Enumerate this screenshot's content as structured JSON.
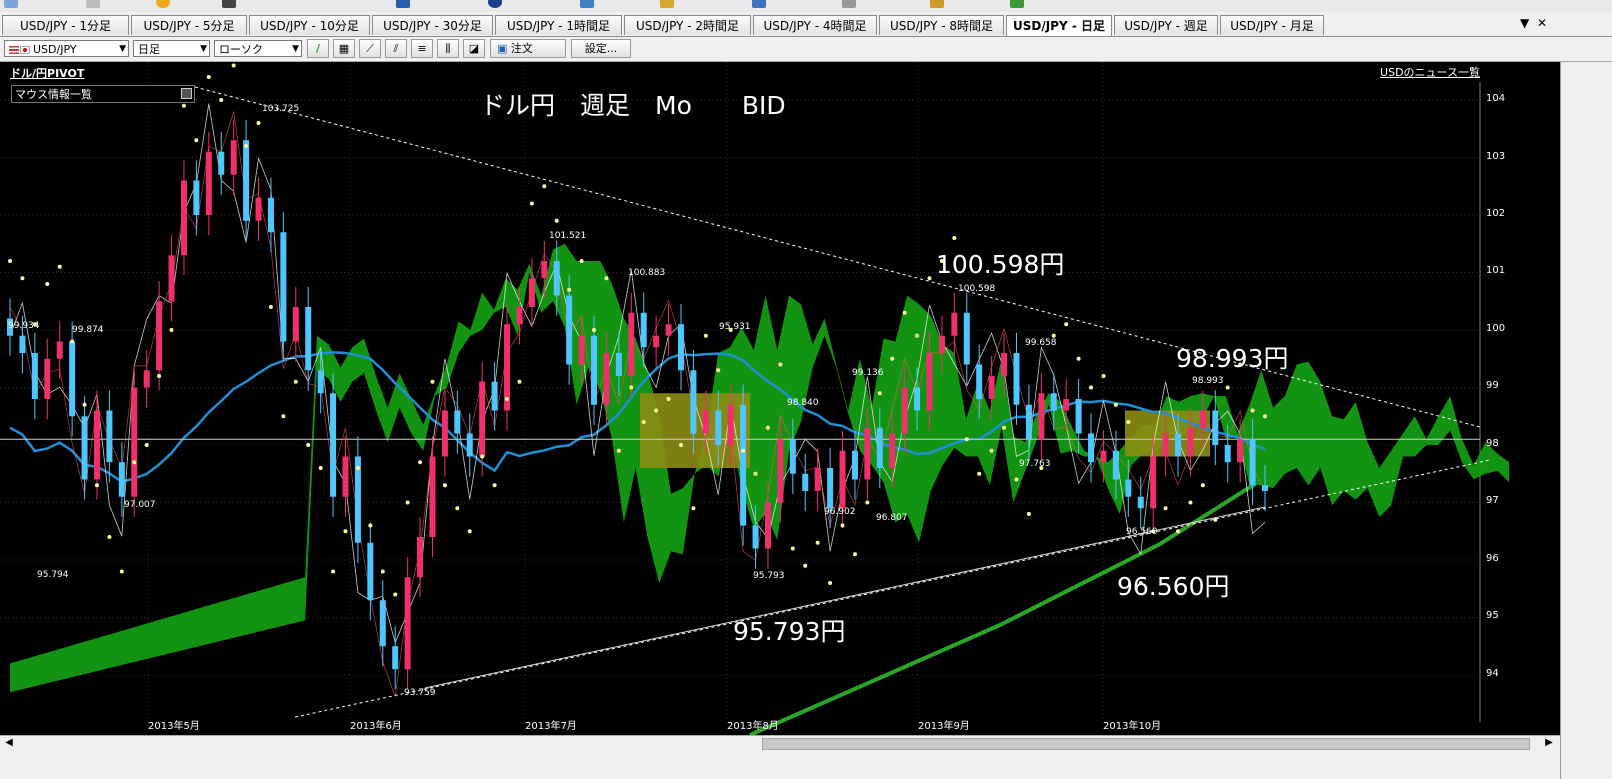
{
  "tabs": [
    "USD/JPY - 1分足",
    "USD/JPY - 5分足",
    "USD/JPY - 10分足",
    "USD/JPY - 30分足",
    "USD/JPY - 1時間足",
    "USD/JPY - 2時間足",
    "USD/JPY - 4時間足",
    "USD/JPY - 8時間足",
    "USD/JPY - 日足",
    "USD/JPY - 週足",
    "USD/JPY - 月足"
  ],
  "active_tab": "USD/JPY - 日足",
  "toolbar": {
    "pair": "USD/JPY",
    "timeframe": "日足",
    "chart_type": "ローソク",
    "order_label": "注文",
    "settings_label": "設定..."
  },
  "chart": {
    "pivot_title": "ドル/円PIVOT",
    "news_link": "USDのニュース一覧",
    "mouse_info": "マウス情報一覧",
    "headline": "ドル円　週足　Mo　　BID",
    "annotations": [
      "100.598円",
      "98.993円",
      "95.793円",
      "96.560円"
    ],
    "point_labels": [
      "103.725",
      "101.521",
      "100.883",
      "99.934",
      "99.874",
      "97.007",
      "95.794",
      "93.759",
      "95.931",
      "99.136",
      "98.840",
      "96.902",
      "96.807",
      "95.793",
      "100.598",
      "99.658",
      "97.763",
      "98.993",
      "96.560"
    ],
    "y_ticks": [
      "104",
      "103",
      "102",
      "101",
      "100",
      "99",
      "98",
      "97",
      "96",
      "95",
      "94"
    ],
    "x_ticks": [
      "2013年5月",
      "2013年6月",
      "2013年7月",
      "2013年8月",
      "2013年9月",
      "2013年10月"
    ],
    "colors": {
      "bull": "#f0306a",
      "bear": "#4ec6ff",
      "cloud": "#139c13",
      "cloud_bear": "#8c8c14",
      "ma": "#1f8fd6",
      "long_ma": "#2aa52a",
      "psar": "#ffff99"
    }
  },
  "chart_data": {
    "type": "candlestick",
    "title": "ドル円　週足　Mo　　BID",
    "pair": "USD/JPY",
    "ylim": [
      93.5,
      104.2
    ],
    "x": [
      "2013年5月",
      "2013年6月",
      "2013年7月",
      "2013年8月",
      "2013年9月",
      "2013年10月"
    ],
    "key_levels": {
      "high_may": 103.725,
      "high_jul": 101.521,
      "jul_2": 100.883,
      "high_sep": 100.598,
      "high_oct": 98.993,
      "low_jun": 93.759,
      "low_aug": 95.793,
      "low_oct": 96.56,
      "pivot_level": 98.1
    },
    "closes": [
      99.9,
      99.6,
      98.8,
      99.5,
      99.8,
      98.5,
      97.4,
      98.6,
      97.7,
      97.1,
      99.0,
      99.3,
      100.5,
      101.3,
      102.6,
      102.0,
      103.1,
      102.7,
      103.3,
      101.9,
      102.3,
      101.7,
      99.8,
      100.4,
      99.3,
      98.9,
      97.1,
      97.8,
      96.3,
      95.3,
      94.5,
      94.1,
      95.7,
      96.4,
      97.8,
      98.6,
      98.2,
      97.8,
      99.1,
      98.6,
      100.1,
      100.4,
      100.9,
      101.2,
      100.6,
      99.4,
      99.9,
      98.7,
      99.6,
      99.2,
      100.3,
      99.7,
      99.9,
      100.1,
      99.3,
      98.2,
      98.6,
      98.0,
      98.7,
      96.6,
      96.2,
      97.0,
      98.1,
      97.5,
      97.2,
      97.6,
      96.9,
      97.9,
      97.4,
      98.3,
      97.6,
      98.2,
      99.0,
      98.6,
      99.6,
      99.9,
      100.3,
      99.4,
      98.8,
      99.2,
      99.6,
      98.7,
      98.1,
      98.9,
      98.6,
      98.8,
      98.2,
      97.7,
      97.9,
      97.4,
      97.1,
      96.9,
      97.8,
      98.2,
      97.8,
      98.3,
      98.6,
      98.0,
      97.7,
      98.1,
      97.3,
      97.2
    ]
  }
}
